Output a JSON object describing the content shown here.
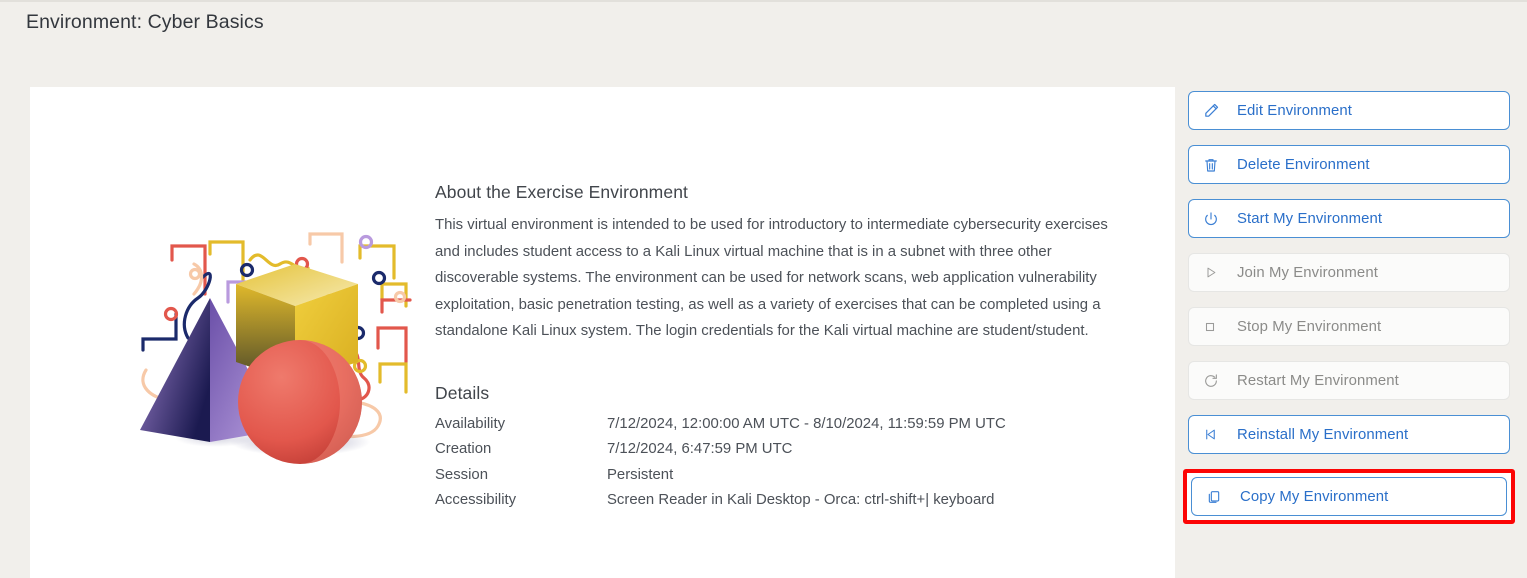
{
  "header": {
    "title": "Environment: Cyber Basics"
  },
  "illustration": {
    "name": "abstract-3d-shapes-illustration",
    "shapes": [
      "purple-pyramid",
      "gold-cube",
      "red-sphere",
      "circuit-traces"
    ],
    "colors": {
      "pyramid": "#7e5fb5",
      "cube": "#e3bb2b",
      "sphere": "#e2574c",
      "trace_navy": "#1b2a6b",
      "trace_red": "#e2574c",
      "trace_gold": "#e3bb2b",
      "trace_peach": "#f7c9a8",
      "trace_violet": "#b99ade"
    }
  },
  "about": {
    "heading": "About the Exercise Environment",
    "body": "This virtual environment is intended to be used for introductory to intermediate cybersecurity exercises and includes student access to a Kali Linux virtual machine that is in a subnet with three other discoverable systems. The environment can be used for network scans, web application vulnerability exploitation, basic penetration testing, as well as a variety of exercises that can be completed using a standalone Kali Linux system. The login credentials for the Kali virtual machine are student/student."
  },
  "details": {
    "heading": "Details",
    "rows": [
      {
        "label": "Availability",
        "value": "7/12/2024, 12:00:00 AM UTC - 8/10/2024, 11:59:59 PM UTC"
      },
      {
        "label": "Creation",
        "value": "7/12/2024, 6:47:59 PM UTC"
      },
      {
        "label": "Session",
        "value": "Persistent"
      },
      {
        "label": "Accessibility",
        "value": "Screen Reader in Kali Desktop - Orca: ctrl-shift+| keyboard"
      }
    ]
  },
  "actions": {
    "items": [
      {
        "label": "Edit Environment",
        "icon": "pencil-icon",
        "enabled": true,
        "highlighted": false
      },
      {
        "label": "Delete Environment",
        "icon": "trash-icon",
        "enabled": true,
        "highlighted": false
      },
      {
        "label": "Start My Environment",
        "icon": "power-icon",
        "enabled": true,
        "highlighted": false
      },
      {
        "label": "Join My Environment",
        "icon": "play-icon",
        "enabled": false,
        "highlighted": false
      },
      {
        "label": "Stop My Environment",
        "icon": "stop-icon",
        "enabled": false,
        "highlighted": false
      },
      {
        "label": "Restart My Environment",
        "icon": "restart-icon",
        "enabled": false,
        "highlighted": false
      },
      {
        "label": "Reinstall My Environment",
        "icon": "skip-back-icon",
        "enabled": true,
        "highlighted": false
      },
      {
        "label": "Copy My Environment",
        "icon": "copy-icon",
        "enabled": true,
        "highlighted": true
      }
    ]
  },
  "colors": {
    "page_background": "#f1efeb",
    "card_background": "#ffffff",
    "accent_blue": "#2a6fc9",
    "border_blue": "#4a8fd4",
    "highlight_red": "#fc0505",
    "text_primary": "#41454b",
    "text_body": "#4c5158",
    "text_disabled": "#8b8b89"
  }
}
